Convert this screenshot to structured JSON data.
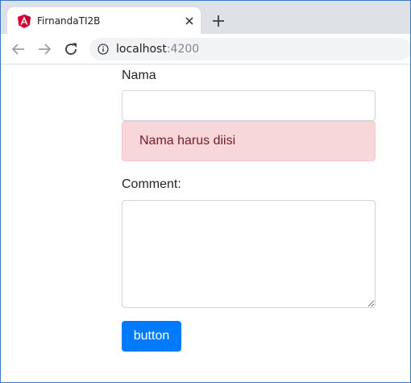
{
  "browser": {
    "tab": {
      "title": "FirnandaTI2B",
      "favicon": "angular-icon",
      "close_icon": "close-icon"
    },
    "new_tab_icon": "plus-icon",
    "toolbar": {
      "back_icon": "back-arrow-icon",
      "forward_icon": "forward-arrow-icon",
      "reload_icon": "reload-icon",
      "info_icon": "info-icon",
      "url_host": "localhost",
      "url_port": ":4200"
    }
  },
  "form": {
    "nama_label": "Nama",
    "nama_value": "",
    "nama_error": "Nama harus diisi",
    "comment_label": "Comment:",
    "comment_value": "",
    "submit_label": "button"
  },
  "colors": {
    "primary": "#007bff",
    "danger_bg": "#f8d7da",
    "danger_text": "#721c24",
    "angular_red": "#dd0031"
  }
}
